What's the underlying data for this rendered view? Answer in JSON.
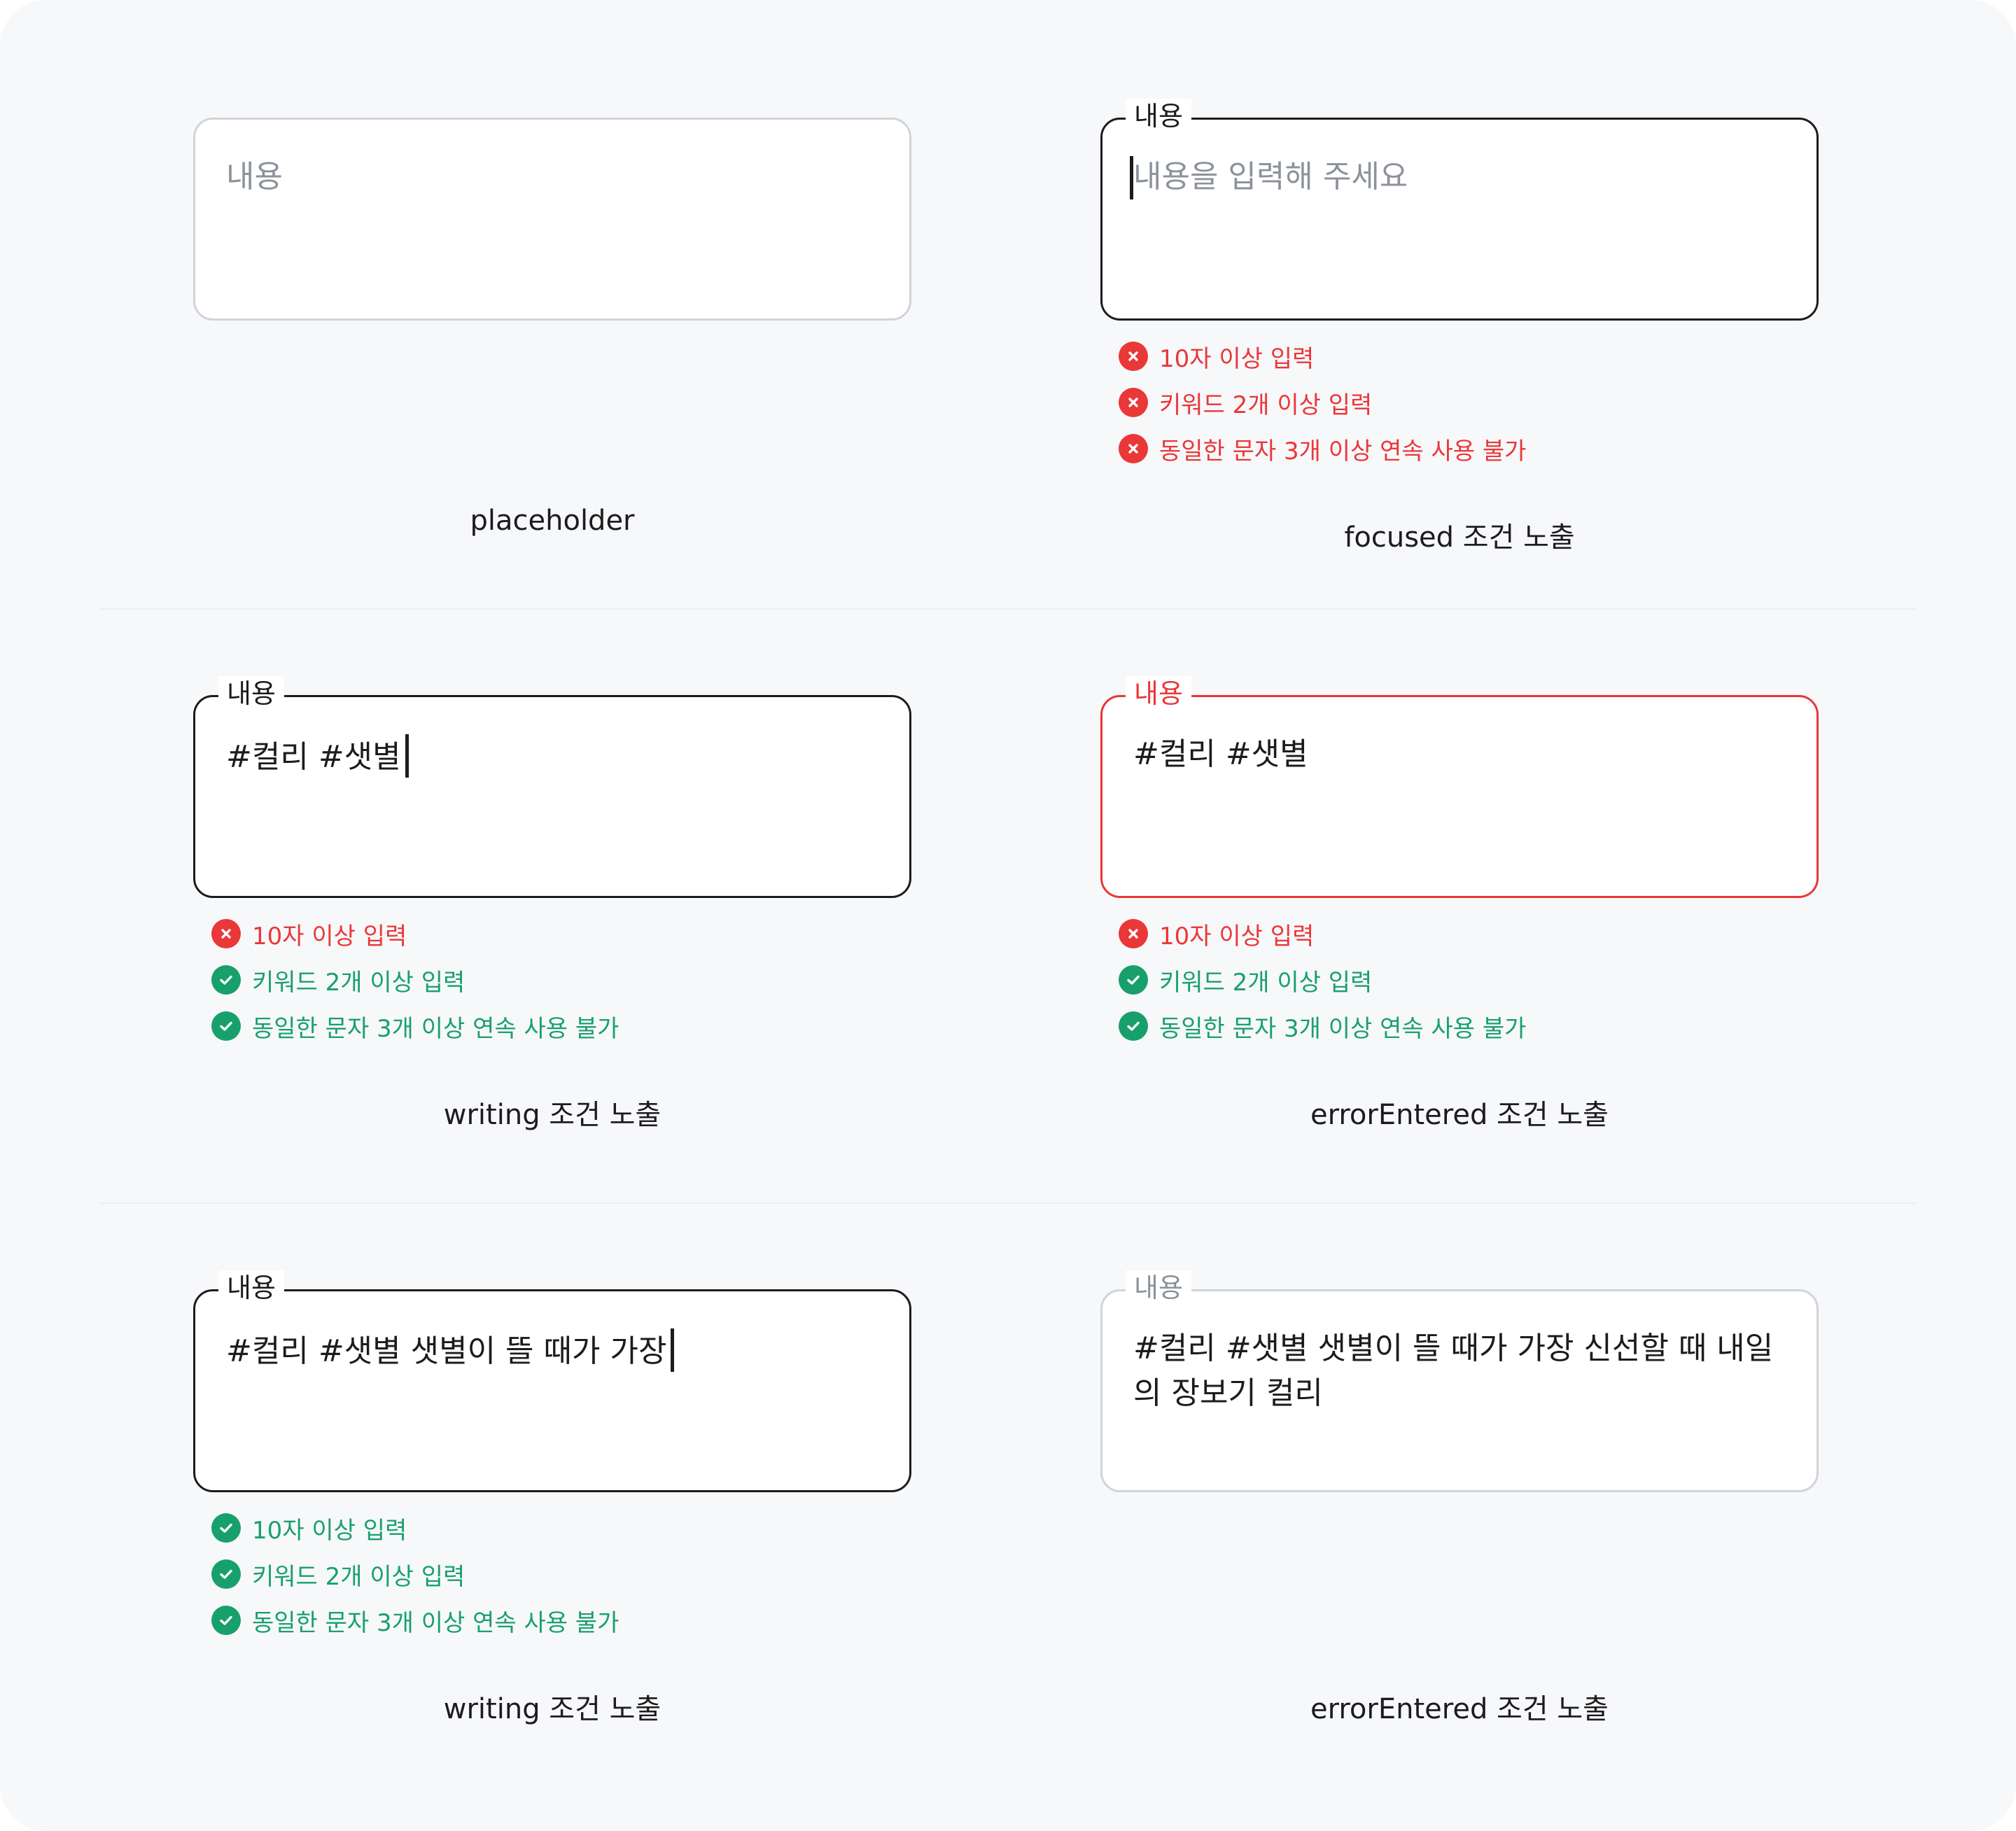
{
  "colors": {
    "canvas": "#f7f8fa",
    "border_default": "#1c1c1e",
    "border_idle": "#d0d4d9",
    "error": "#ea3738",
    "success": "#18a06c",
    "placeholder": "#8c929a"
  },
  "icons": {
    "fail": "x-circle-icon",
    "pass": "check-circle-icon"
  },
  "examples": {
    "placeholder": {
      "label": "내용",
      "caption": "placeholder"
    },
    "focused": {
      "label": "내용",
      "placeholder": "내용을 입력해 주세요",
      "caption": "focused 조건 노출",
      "rules": [
        {
          "text": "10자 이상 입력",
          "status": "fail"
        },
        {
          "text": "키워드 2개 이상 입력",
          "status": "fail"
        },
        {
          "text": "동일한 문자 3개 이상 연속 사용 불가",
          "status": "fail"
        }
      ]
    },
    "writing_short": {
      "label": "내용",
      "value": "#컬리 #샛별",
      "caption": "writing 조건 노출",
      "rules": [
        {
          "text": "10자 이상 입력",
          "status": "fail"
        },
        {
          "text": "키워드 2개 이상 입력",
          "status": "pass"
        },
        {
          "text": "동일한 문자 3개 이상 연속 사용 불가",
          "status": "pass"
        }
      ]
    },
    "error_entered": {
      "label": "내용",
      "value": "#컬리 #샛별",
      "caption": "errorEntered 조건 노출",
      "rules": [
        {
          "text": "10자 이상 입력",
          "status": "fail"
        },
        {
          "text": "키워드 2개 이상 입력",
          "status": "pass"
        },
        {
          "text": "동일한 문자 3개 이상 연속 사용 불가",
          "status": "pass"
        }
      ]
    },
    "writing_long": {
      "label": "내용",
      "value": "#컬리 #샛별 샛별이 뜰 때가 가장",
      "caption": "writing 조건 노출",
      "rules": [
        {
          "text": "10자 이상 입력",
          "status": "pass"
        },
        {
          "text": "키워드 2개 이상 입력",
          "status": "pass"
        },
        {
          "text": "동일한 문자 3개 이상 연속 사용 불가",
          "status": "pass"
        }
      ]
    },
    "entered": {
      "label": "내용",
      "value": "#컬리 #샛별 샛별이 뜰 때가 가장 신선할 때 내일의 장보기 컬리",
      "caption": "errorEntered 조건 노출"
    }
  }
}
